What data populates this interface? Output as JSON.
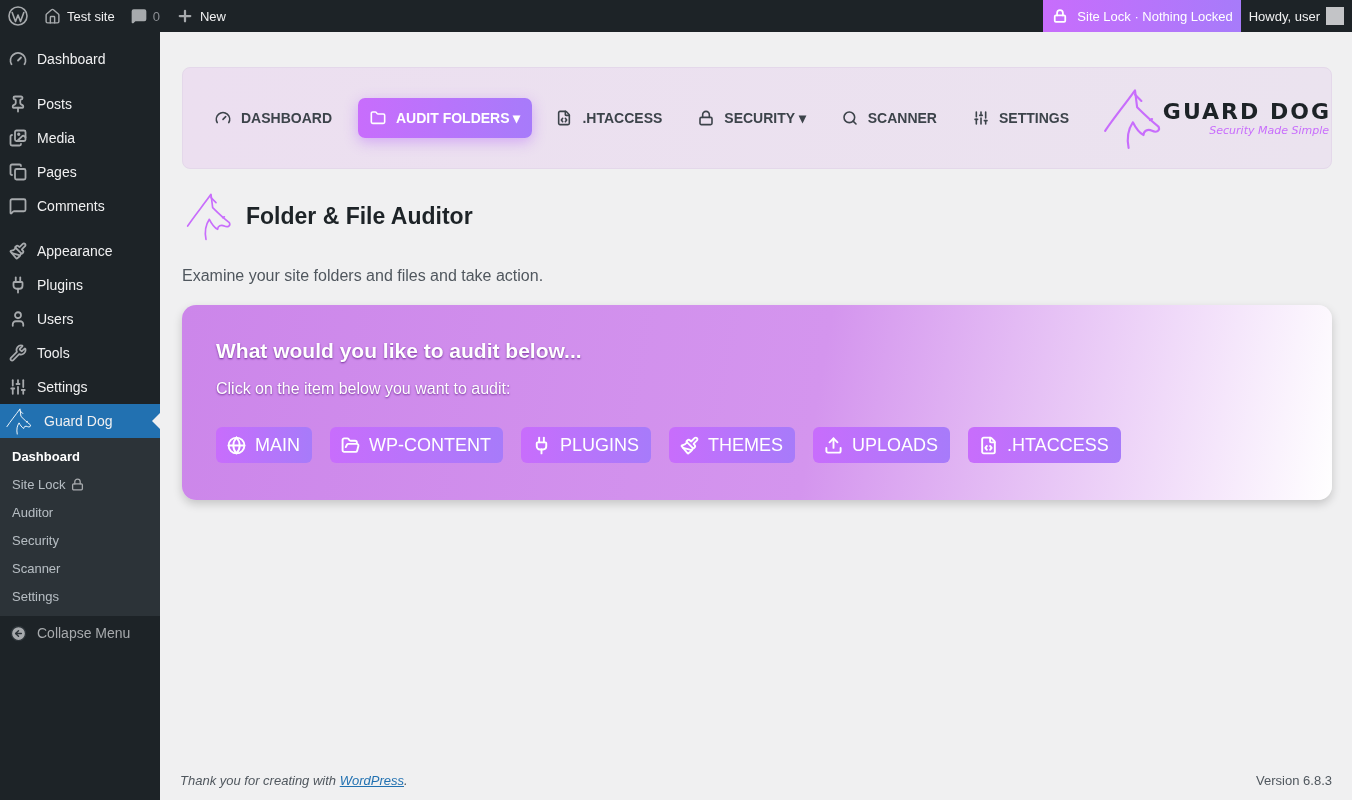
{
  "topbar": {
    "site_name": "Test site",
    "comments": "0",
    "new": "New",
    "site_lock": "Site Lock · Nothing Locked",
    "howdy": "Howdy, user"
  },
  "sidebar": {
    "groups": [
      [
        {
          "label": "Dashboard",
          "selected": false
        }
      ],
      [
        {
          "label": "Posts",
          "selected": false
        },
        {
          "label": "Media",
          "selected": false
        },
        {
          "label": "Pages",
          "selected": false
        },
        {
          "label": "Comments",
          "selected": false
        }
      ],
      [
        {
          "label": "Appearance",
          "selected": false
        },
        {
          "label": "Plugins",
          "selected": false
        },
        {
          "label": "Users",
          "selected": false
        },
        {
          "label": "Tools",
          "selected": false
        },
        {
          "label": "Settings",
          "selected": false
        },
        {
          "label": "Guard Dog",
          "selected": true
        }
      ]
    ],
    "submenu": [
      {
        "label": "Dashboard",
        "selected": true
      },
      {
        "label": "Site Lock",
        "selected": false
      },
      {
        "label": "Auditor",
        "selected": false
      },
      {
        "label": "Security",
        "selected": false
      },
      {
        "label": "Scanner",
        "selected": false
      },
      {
        "label": "Settings",
        "selected": false
      }
    ],
    "collapse": "Collapse Menu"
  },
  "plugin_nav": {
    "items": [
      {
        "label": "DASHBOARD",
        "selected": false
      },
      {
        "label": "AUDIT FOLDERS ▾",
        "selected": true
      },
      {
        "label": ".HTACCESS",
        "selected": false
      },
      {
        "label": "SECURITY ▾",
        "selected": false
      },
      {
        "label": "SCANNER",
        "selected": false
      },
      {
        "label": "SETTINGS",
        "selected": false
      }
    ],
    "logo": {
      "name": "GUARD DOG",
      "tagline": "Security Made Simple"
    }
  },
  "page": {
    "title": "Folder & File Auditor",
    "description": "Examine your site folders and files and take action."
  },
  "card": {
    "heading": "What would you like to audit below...",
    "instruction": "Click on the item below you want to audit:",
    "buttons": [
      {
        "label": "MAIN"
      },
      {
        "label": "WP-CONTENT"
      },
      {
        "label": "PLUGINS"
      },
      {
        "label": "THEMES"
      },
      {
        "label": "UPLOADS"
      },
      {
        "label": ".HTACCESS"
      }
    ]
  },
  "footer": {
    "thanks": "Thank you for creating with",
    "link": "WordPress",
    "after": ".",
    "version": "Version 6.8.3"
  }
}
